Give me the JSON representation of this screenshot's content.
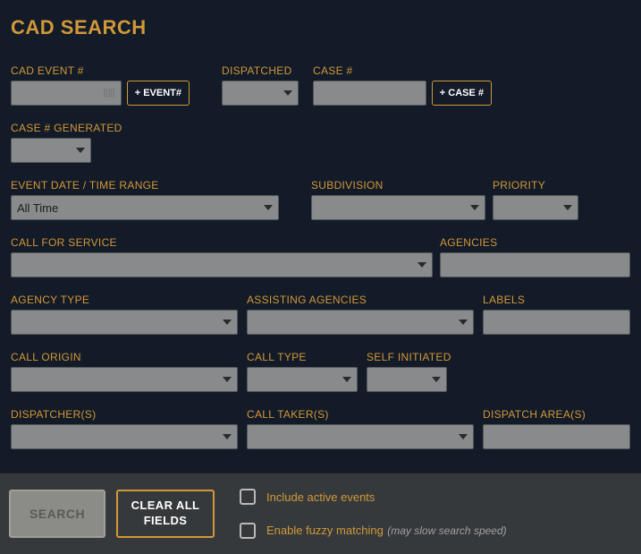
{
  "title": "CAD SEARCH",
  "labels": {
    "cad_event": "CAD EVENT #",
    "dispatched": "DISPATCHED",
    "case_num": "CASE #",
    "case_generated": "CASE # GENERATED",
    "event_date": "EVENT DATE / TIME RANGE",
    "subdivision": "SUBDIVISION",
    "priority": "PRIORITY",
    "call_for_service": "CALL FOR SERVICE",
    "agencies": "AGENCIES",
    "agency_type": "AGENCY TYPE",
    "assisting_agencies": "ASSISTING AGENCIES",
    "labels_field": "LABELS",
    "call_origin": "CALL ORIGIN",
    "call_type": "CALL TYPE",
    "self_initiated": "SELF INITIATED",
    "dispatchers": "DISPATCHER(S)",
    "call_takers": "CALL TAKER(S)",
    "dispatch_areas": "DISPATCH AREA(S)"
  },
  "values": {
    "cad_event": "",
    "dispatched": "",
    "case_num": "",
    "case_generated": "",
    "event_date": "All Time",
    "subdivision": "",
    "priority": "",
    "call_for_service": "",
    "agencies": "",
    "agency_type": "",
    "assisting_agencies": "",
    "labels_field": "",
    "call_origin": "",
    "call_type": "",
    "self_initiated": "",
    "dispatchers": "",
    "call_takers": "",
    "dispatch_areas": ""
  },
  "buttons": {
    "add_event": "+ EVENT#",
    "add_case": "+ CASE #",
    "search": "SEARCH",
    "clear": "CLEAR ALL FIELDS"
  },
  "checks": {
    "include_active": "Include active events",
    "fuzzy": "Enable fuzzy matching",
    "fuzzy_hint": "(may slow search speed)"
  }
}
